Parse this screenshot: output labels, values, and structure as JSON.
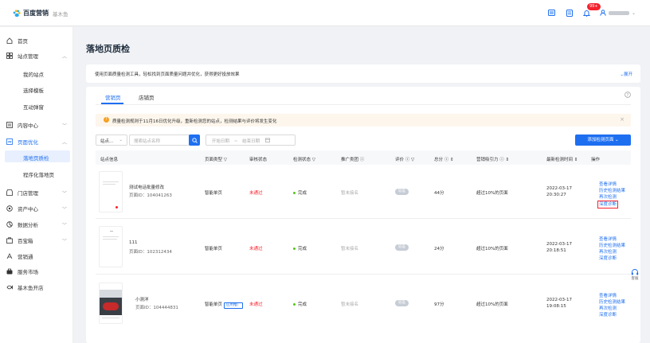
{
  "brand": {
    "name": "百度营销",
    "sub": "基木鱼"
  },
  "header": {
    "notification_count": "99+"
  },
  "sidebar": {
    "home": "首页",
    "site_mgmt": "站点管理",
    "my_sites": "我的站点",
    "choose_template": "选择模板",
    "interactive_popup": "互动弹窗",
    "content_center": "内容中心",
    "page_optimize": "页面优化",
    "landing_check": "落地页质检",
    "mini_program_landing": "程序化落地页",
    "store_mgmt": "门店管理",
    "asset_center": "资产中心",
    "data_analysis": "数据分析",
    "toolbox": "百宝箱",
    "marketing_pass": "营销通",
    "service_market": "服务市场",
    "jimuyu_store": "基木鱼开店"
  },
  "page": {
    "title": "落地页质检",
    "description": "使用页面质量检测工具，轻松找到页面质量问题并优化，获得更好投放效果",
    "expand": "⌄展开"
  },
  "tabs": [
    "营销页",
    "店铺页"
  ],
  "notice": "质量检测规则于11月16日优化升级，重新检测您的站点，检测结果与评价将发生变化",
  "filters": {
    "site_select": "站点...",
    "search_placeholder": "搜索站点名称",
    "start_date": "开始日期",
    "end_date": "结束日期",
    "date_sep": "~",
    "add_button": "添加检测页面 ⌄"
  },
  "table": {
    "headers": [
      "站点信息",
      "页面类型 ▽",
      "审核状态",
      "检测状态 ▽",
      "推广类团 ⓘ",
      "评价 ⓘ ▽",
      "总分 ⓘ ⇕",
      "营销吸引力 ⓘ ⇕",
      "最新检测时间 ⇕",
      "操作"
    ],
    "rows": [
      {
        "name": "测试电话批量修改",
        "page_id": "页面ID：104041263",
        "type": "智能单页",
        "promo_tag": "",
        "review": "未通过",
        "status": "完成",
        "promo": "暂未接名",
        "rating": "较差",
        "score": "44分",
        "attract": "超过10%的页面",
        "date": "2022-03-17",
        "time": "20:30:27",
        "ops": [
          "查看详情",
          "历史检测结果",
          "再次检测",
          "深度诊断"
        ]
      },
      {
        "name": "111",
        "page_id": "页面ID：102312434",
        "type": "智能单页",
        "promo_tag": "",
        "review": "未通过",
        "status": "完成",
        "promo": "暂未接名",
        "rating": "较差",
        "score": "24分",
        "attract": "超过10%的页面",
        "date": "2022-03-17",
        "time": "20:18:51",
        "ops": [
          "查看详情",
          "历史检测结果",
          "再次检测",
          "深度诊断"
        ]
      },
      {
        "name": "小测洋",
        "page_id": "页面ID：104444831",
        "type": "智能单页",
        "promo_tag": "应用推广",
        "review": "未通过",
        "status": "完成",
        "promo": "暂未接名",
        "rating": "较差",
        "score": "97分",
        "attract": "超过10%的页面",
        "date": "2022-03-17",
        "time": "19:08:15",
        "ops": [
          "查看详情",
          "历史检测结果",
          "再次检测",
          "深度诊断"
        ]
      }
    ]
  },
  "float_help": "客服",
  "colors": {
    "accent": "#1e6ff0",
    "danger": "#f5222d",
    "success": "#52c41a",
    "warning": "#f7a020"
  }
}
